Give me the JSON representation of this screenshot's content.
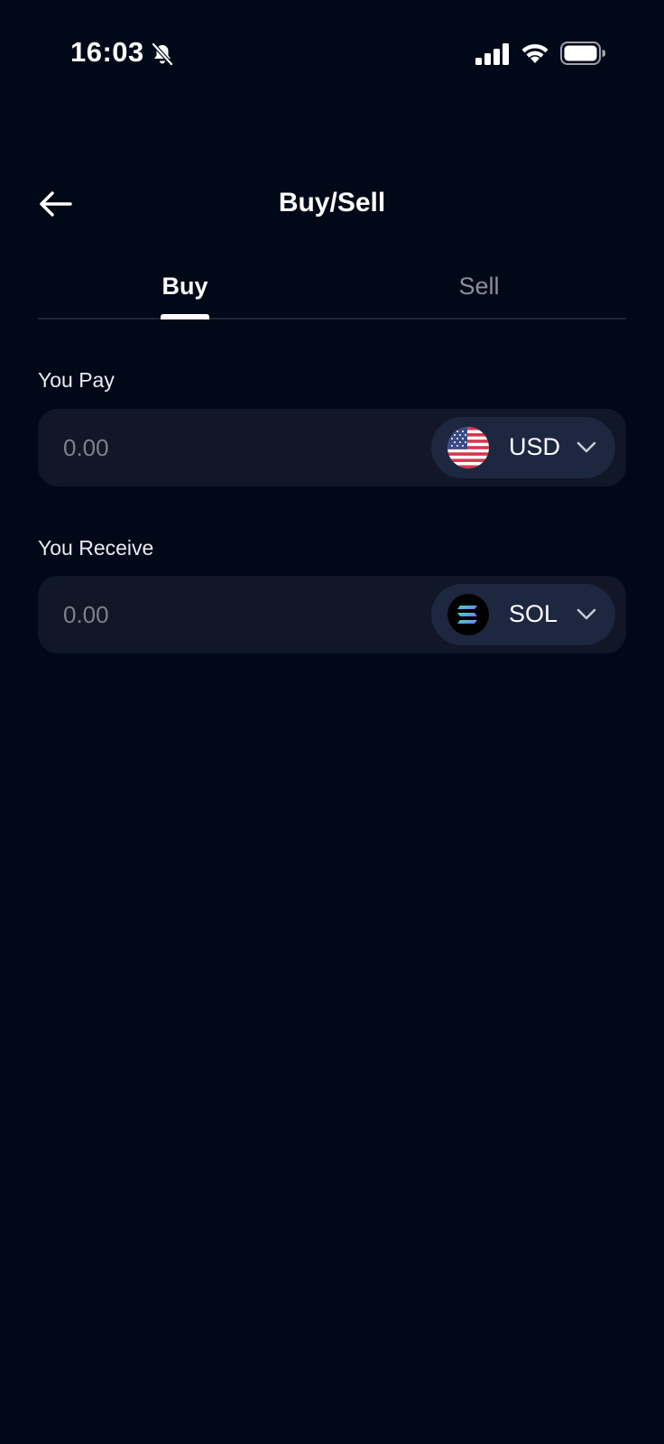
{
  "status_bar": {
    "time": "16:03",
    "icons": [
      "bell-off-icon",
      "cellular-signal-icon",
      "wifi-icon",
      "battery-icon"
    ]
  },
  "header": {
    "title": "Buy/Sell",
    "back_icon": "arrow-left-icon"
  },
  "tabs": [
    {
      "label": "Buy",
      "active": true
    },
    {
      "label": "Sell",
      "active": false
    }
  ],
  "pay": {
    "label": "You Pay",
    "placeholder": "0.00",
    "value": "",
    "currency": {
      "code": "USD",
      "icon": "us-flag-icon"
    }
  },
  "receive": {
    "label": "You Receive",
    "placeholder": "0.00",
    "value": "",
    "currency": {
      "code": "SOL",
      "icon": "solana-icon"
    }
  },
  "colors": {
    "background": "#010817",
    "field": "#111726",
    "selector": "#1e2740",
    "muted_text": "#7c818d",
    "divider": "#1f2739"
  }
}
